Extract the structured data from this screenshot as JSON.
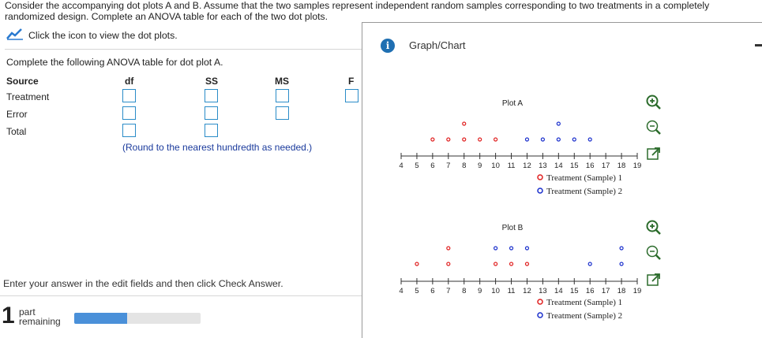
{
  "instructions": {
    "line1": "Consider the accompanying dot plots A and B. Assume that the two samples represent independent random samples corresponding to two treatments in a completely",
    "line2": "randomized design. Complete an ANOVA table for each of the two dot plots."
  },
  "icon_link": {
    "label": "Click the icon to view the dot plots."
  },
  "anova": {
    "prompt": "Complete the following ANOVA table for dot plot A.",
    "headers": {
      "source": "Source",
      "df": "df",
      "ss": "SS",
      "ms": "MS",
      "f": "F"
    },
    "rows": {
      "treatment": "Treatment",
      "error": "Error",
      "total": "Total"
    },
    "rounding_note": "(Round to the nearest hundredth as needed.)"
  },
  "footer": {
    "enter_msg": "Enter your answer in the edit fields and then click Check Answer.",
    "parts_number": "1",
    "part_label": "part",
    "remaining_label": "remaining",
    "progress_fraction": 0.42
  },
  "graph_panel": {
    "title": "Graph/Chart",
    "info_glyph": "i"
  },
  "colors": {
    "treatment1": "#e02020",
    "treatment2": "#1a2fcc",
    "accent": "#2a8cc8"
  },
  "chart_data": [
    {
      "type": "scatter",
      "title": "Plot A",
      "x_ticks": [
        "4",
        "5",
        "6",
        "7",
        "8",
        "9",
        "10",
        "11",
        "12",
        "13",
        "14",
        "15",
        "16",
        "17",
        "18",
        "19"
      ],
      "xlim": [
        4,
        19
      ],
      "series": [
        {
          "name": "Treatment (Sample) 1",
          "x": [
            6,
            7,
            8,
            8,
            9,
            10
          ]
        },
        {
          "name": "Treatment (Sample) 2",
          "x": [
            12,
            13,
            14,
            14,
            15,
            16
          ]
        }
      ],
      "legend": [
        "Treatment (Sample) 1",
        "Treatment (Sample) 2"
      ]
    },
    {
      "type": "scatter",
      "title": "Plot B",
      "x_ticks": [
        "4",
        "5",
        "6",
        "7",
        "8",
        "9",
        "10",
        "11",
        "12",
        "13",
        "14",
        "15",
        "16",
        "17",
        "18",
        "19"
      ],
      "xlim": [
        4,
        19
      ],
      "series": [
        {
          "name": "Treatment (Sample) 1",
          "x": [
            5,
            7,
            7,
            10,
            11,
            12
          ]
        },
        {
          "name": "Treatment (Sample) 2",
          "x": [
            10,
            11,
            12,
            16,
            18,
            18
          ]
        }
      ],
      "legend": [
        "Treatment (Sample) 1",
        "Treatment (Sample) 2"
      ]
    }
  ]
}
